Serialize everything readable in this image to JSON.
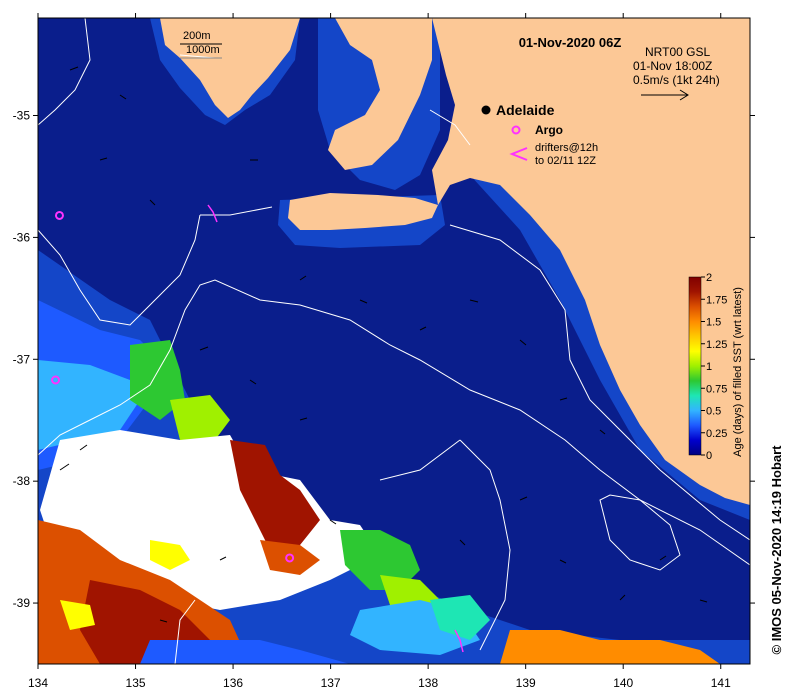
{
  "map": {
    "title": "01-Nov-2020 06Z",
    "product": {
      "line1": "NRT00 GSL",
      "line2": "01-Nov 18:00Z",
      "line3": "0.5m/s (1kt 24h)"
    },
    "depth_legend": {
      "line1": "200m",
      "line2": "1000m"
    },
    "place": {
      "name": "Adelaide",
      "lon": 138.6,
      "lat": -34.93
    },
    "argo_label": "Argo",
    "drifter_label": {
      "line1": "drifters@12h",
      "line2": "to 02/11 12Z"
    },
    "copyright": "© IMOS 05-Nov-2020 14:19 Hobart",
    "axes": {
      "lon_ticks": [
        "134",
        "135",
        "136",
        "137",
        "138",
        "139",
        "140",
        "141"
      ],
      "lat_ticks": [
        "-35",
        "-36",
        "-37",
        "-38",
        "-39"
      ],
      "lon_range": [
        134,
        141.3
      ],
      "lat_range": [
        -39.5,
        -34.2
      ]
    },
    "colorbar": {
      "label": "Age (days) of filled SST (wrt latest)",
      "ticks": [
        "2",
        "1.75",
        "1.5",
        "1.25",
        "1",
        "0.75",
        "0.5",
        "0.25",
        "0"
      ],
      "range": [
        0,
        2
      ],
      "colors": [
        "#000080",
        "#0000cd",
        "#1e5aff",
        "#32b4ff",
        "#1ee6b4",
        "#2dc832",
        "#a0f000",
        "#ffff00",
        "#ffc800",
        "#ff8c00",
        "#dc5000",
        "#a01400",
        "#800000"
      ]
    },
    "colors": {
      "ocean": "#0a1e8c",
      "shelf": "#1446c8",
      "land": "#fcc896",
      "no_data": "#ffffff",
      "argo": "#ff32ff",
      "contour": "#ffffff"
    },
    "argo_floats": [
      {
        "lon": 134.22,
        "lat": -35.82
      },
      {
        "lon": 134.18,
        "lat": -37.17
      },
      {
        "lon": 136.58,
        "lat": -38.63
      }
    ]
  }
}
